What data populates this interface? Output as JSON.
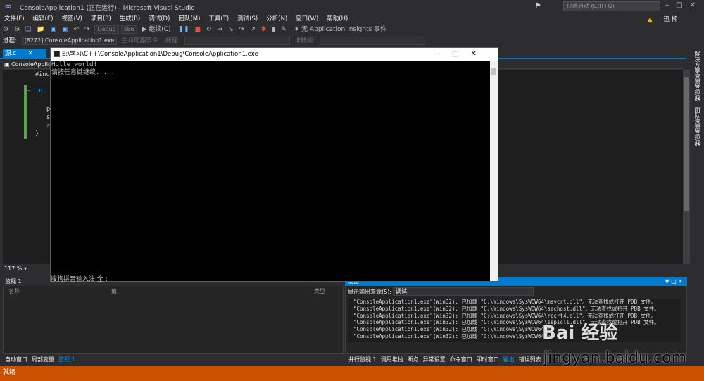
{
  "window": {
    "title": "ConsoleApplication1 (正在运行) - Microsoft Visual Studio",
    "quick_launch_placeholder": "快速启动 (Ctrl+Q)",
    "user_name": "迅 楠"
  },
  "menu": [
    "文件(F)",
    "编辑(E)",
    "视图(V)",
    "项目(P)",
    "生成(B)",
    "调试(D)",
    "团队(M)",
    "工具(T)",
    "测试(S)",
    "分析(N)",
    "窗口(W)",
    "帮助(H)"
  ],
  "toolbar": {
    "config": "Debug",
    "platform": "x86",
    "continue_label": "继续(C)",
    "insights_label": "无 Application Insights 事件"
  },
  "process_bar": {
    "process_label": "进程:",
    "process_value": "[8272] ConsoleApplication1.exe",
    "lifecycle_label": "生命周期事件",
    "thread_label": "线程:",
    "stack_label": "堆栈帧:"
  },
  "doc_tab": {
    "label": "源.c",
    "nav_combo": "ConsoleApplic"
  },
  "editor": {
    "lines": [
      "#incl",
      "int m",
      "{",
      "p",
      "s",
      "r",
      "}"
    ]
  },
  "zoom": "117 %",
  "right_rail": [
    "解决方案资源管理器",
    "团队资源管理器"
  ],
  "watch": {
    "title": "监视 1",
    "col_name": "名称",
    "col_value": "值",
    "col_type": "类型"
  },
  "output": {
    "title": "输出",
    "source_label": "显示输出来源(S):",
    "source_value": "调试",
    "lines": [
      "\"ConsoleApplication1.exe\"(Win32): 已加载 \"C:\\Windows\\SysWOW64\\msvcrt.dll\"。无法查找或打开 PDB 文件。",
      "\"ConsoleApplication1.exe\"(Win32): 已加载 \"C:\\Windows\\SysWOW64\\sechost.dll\"。无法查找或打开 PDB 文件。",
      "\"ConsoleApplication1.exe\"(Win32): 已加载 \"C:\\Windows\\SysWOW64\\rpcrt4.dll\"。无法查找或打开 PDB 文件。",
      "\"ConsoleApplication1.exe\"(Win32): 已加载 \"C:\\Windows\\SysWOW64\\sspicli.dll\"。无法查找或打开 PDB 文件。",
      "\"ConsoleApplication1.exe\"(Win32): 已加载 \"C:\\Windows\\SysWOW64\\c",
      "\"ConsoleApplication1.exe\"(Win32): 已加载 \"C:\\Windows\\SysWOW64\\b"
    ]
  },
  "bottom_tabs_left": [
    "自动窗口",
    "局部变量",
    "监视 1"
  ],
  "bottom_tabs_right": [
    "并行监视 1",
    "调用堆栈",
    "断点",
    "异常设置",
    "命令窗口",
    "即时窗口",
    "输出",
    "错误列表"
  ],
  "status": "就绪",
  "console": {
    "title": "E:\\学习\\C++\\ConsoleApplication1\\Debug\\ConsoleApplication1.exe",
    "line1": "Holle world!",
    "line2": "请按任意键继续. . .",
    "ime": "搜狗拼音输入法 全 :"
  },
  "watermark": {
    "logo": "Bai 经验",
    "url": "jingyan.baidu.com"
  },
  "colors": {
    "accent": "#007acc",
    "status": "#ca5100",
    "console_border": "#7a3e9d"
  }
}
